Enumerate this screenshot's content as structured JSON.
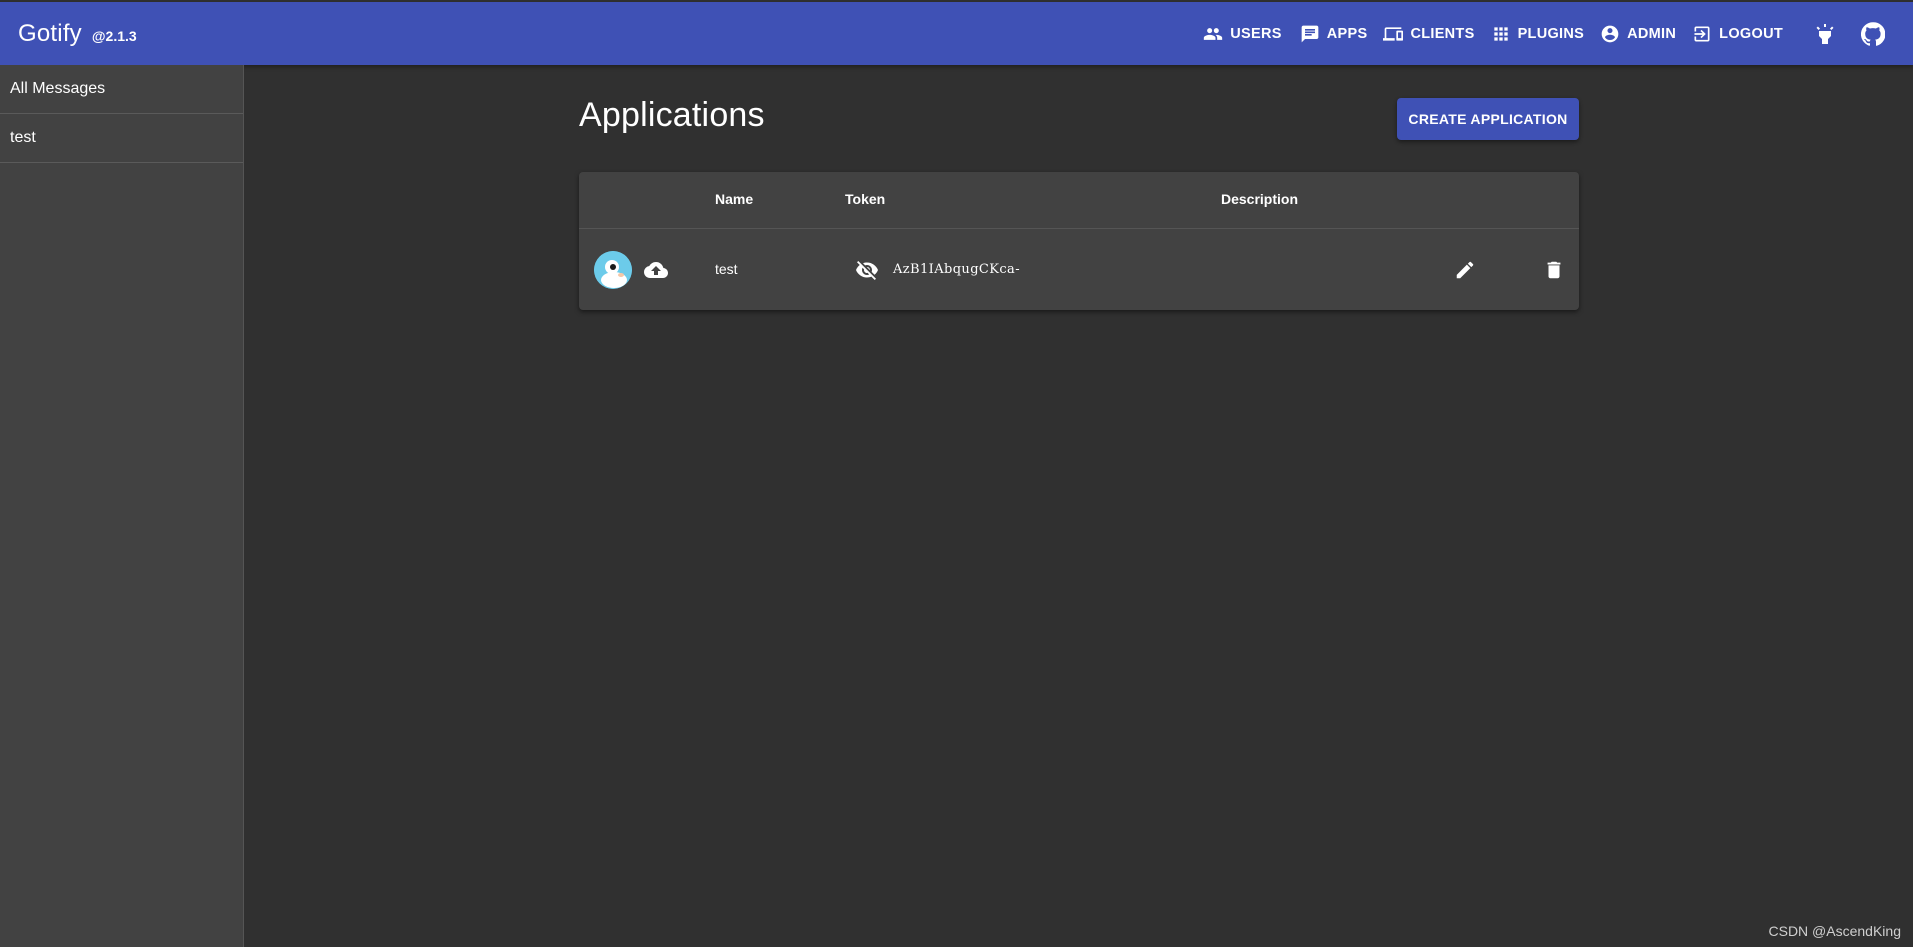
{
  "app": {
    "title": "Gotify",
    "version": "@2.1.3"
  },
  "nav": {
    "users": "USERS",
    "apps": "APPS",
    "clients": "CLIENTS",
    "plugins": "PLUGINS",
    "admin": "ADMIN",
    "logout": "LOGOUT",
    "icons": [
      "users-icon",
      "apps-icon",
      "clients-icon",
      "plugins-icon",
      "admin-icon",
      "logout-icon",
      "lightbulb-icon",
      "github-icon"
    ]
  },
  "sidebar": {
    "items": [
      {
        "label": "All Messages"
      },
      {
        "label": "test"
      }
    ]
  },
  "main": {
    "title": "Applications",
    "create_button": "CREATE APPLICATION",
    "table": {
      "columns": [
        "",
        "Name",
        "Token",
        "Description"
      ],
      "rows": [
        {
          "name": "test",
          "token": "AzB1IAbqugCKca-",
          "description": ""
        }
      ]
    }
  },
  "watermark": "CSDN @AscendKing",
  "colors": {
    "primary": "#3f51b5",
    "background": "#303030",
    "surface": "#424242"
  }
}
